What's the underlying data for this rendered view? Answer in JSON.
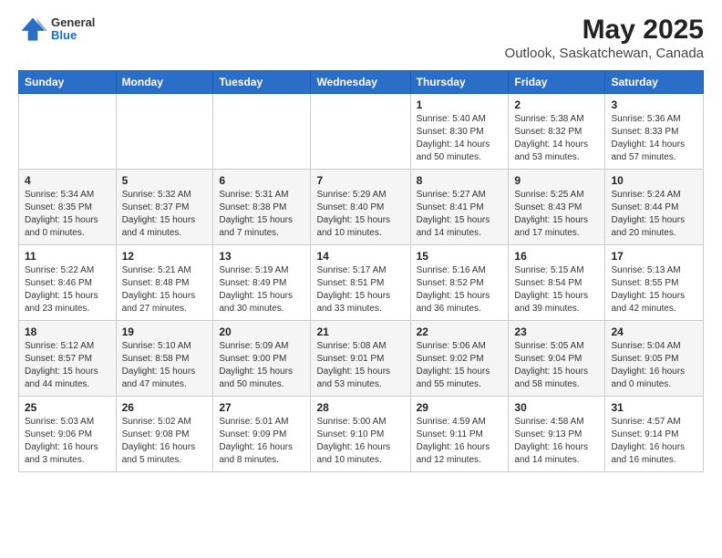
{
  "header": {
    "logo_general": "General",
    "logo_blue": "Blue",
    "title": "May 2025",
    "subtitle": "Outlook, Saskatchewan, Canada"
  },
  "days_of_week": [
    "Sunday",
    "Monday",
    "Tuesday",
    "Wednesday",
    "Thursday",
    "Friday",
    "Saturday"
  ],
  "weeks": [
    [
      {
        "day": "",
        "info": ""
      },
      {
        "day": "",
        "info": ""
      },
      {
        "day": "",
        "info": ""
      },
      {
        "day": "",
        "info": ""
      },
      {
        "day": "1",
        "info": "Sunrise: 5:40 AM\nSunset: 8:30 PM\nDaylight: 14 hours\nand 50 minutes."
      },
      {
        "day": "2",
        "info": "Sunrise: 5:38 AM\nSunset: 8:32 PM\nDaylight: 14 hours\nand 53 minutes."
      },
      {
        "day": "3",
        "info": "Sunrise: 5:36 AM\nSunset: 8:33 PM\nDaylight: 14 hours\nand 57 minutes."
      }
    ],
    [
      {
        "day": "4",
        "info": "Sunrise: 5:34 AM\nSunset: 8:35 PM\nDaylight: 15 hours\nand 0 minutes."
      },
      {
        "day": "5",
        "info": "Sunrise: 5:32 AM\nSunset: 8:37 PM\nDaylight: 15 hours\nand 4 minutes."
      },
      {
        "day": "6",
        "info": "Sunrise: 5:31 AM\nSunset: 8:38 PM\nDaylight: 15 hours\nand 7 minutes."
      },
      {
        "day": "7",
        "info": "Sunrise: 5:29 AM\nSunset: 8:40 PM\nDaylight: 15 hours\nand 10 minutes."
      },
      {
        "day": "8",
        "info": "Sunrise: 5:27 AM\nSunset: 8:41 PM\nDaylight: 15 hours\nand 14 minutes."
      },
      {
        "day": "9",
        "info": "Sunrise: 5:25 AM\nSunset: 8:43 PM\nDaylight: 15 hours\nand 17 minutes."
      },
      {
        "day": "10",
        "info": "Sunrise: 5:24 AM\nSunset: 8:44 PM\nDaylight: 15 hours\nand 20 minutes."
      }
    ],
    [
      {
        "day": "11",
        "info": "Sunrise: 5:22 AM\nSunset: 8:46 PM\nDaylight: 15 hours\nand 23 minutes."
      },
      {
        "day": "12",
        "info": "Sunrise: 5:21 AM\nSunset: 8:48 PM\nDaylight: 15 hours\nand 27 minutes."
      },
      {
        "day": "13",
        "info": "Sunrise: 5:19 AM\nSunset: 8:49 PM\nDaylight: 15 hours\nand 30 minutes."
      },
      {
        "day": "14",
        "info": "Sunrise: 5:17 AM\nSunset: 8:51 PM\nDaylight: 15 hours\nand 33 minutes."
      },
      {
        "day": "15",
        "info": "Sunrise: 5:16 AM\nSunset: 8:52 PM\nDaylight: 15 hours\nand 36 minutes."
      },
      {
        "day": "16",
        "info": "Sunrise: 5:15 AM\nSunset: 8:54 PM\nDaylight: 15 hours\nand 39 minutes."
      },
      {
        "day": "17",
        "info": "Sunrise: 5:13 AM\nSunset: 8:55 PM\nDaylight: 15 hours\nand 42 minutes."
      }
    ],
    [
      {
        "day": "18",
        "info": "Sunrise: 5:12 AM\nSunset: 8:57 PM\nDaylight: 15 hours\nand 44 minutes."
      },
      {
        "day": "19",
        "info": "Sunrise: 5:10 AM\nSunset: 8:58 PM\nDaylight: 15 hours\nand 47 minutes."
      },
      {
        "day": "20",
        "info": "Sunrise: 5:09 AM\nSunset: 9:00 PM\nDaylight: 15 hours\nand 50 minutes."
      },
      {
        "day": "21",
        "info": "Sunrise: 5:08 AM\nSunset: 9:01 PM\nDaylight: 15 hours\nand 53 minutes."
      },
      {
        "day": "22",
        "info": "Sunrise: 5:06 AM\nSunset: 9:02 PM\nDaylight: 15 hours\nand 55 minutes."
      },
      {
        "day": "23",
        "info": "Sunrise: 5:05 AM\nSunset: 9:04 PM\nDaylight: 15 hours\nand 58 minutes."
      },
      {
        "day": "24",
        "info": "Sunrise: 5:04 AM\nSunset: 9:05 PM\nDaylight: 16 hours\nand 0 minutes."
      }
    ],
    [
      {
        "day": "25",
        "info": "Sunrise: 5:03 AM\nSunset: 9:06 PM\nDaylight: 16 hours\nand 3 minutes."
      },
      {
        "day": "26",
        "info": "Sunrise: 5:02 AM\nSunset: 9:08 PM\nDaylight: 16 hours\nand 5 minutes."
      },
      {
        "day": "27",
        "info": "Sunrise: 5:01 AM\nSunset: 9:09 PM\nDaylight: 16 hours\nand 8 minutes."
      },
      {
        "day": "28",
        "info": "Sunrise: 5:00 AM\nSunset: 9:10 PM\nDaylight: 16 hours\nand 10 minutes."
      },
      {
        "day": "29",
        "info": "Sunrise: 4:59 AM\nSunset: 9:11 PM\nDaylight: 16 hours\nand 12 minutes."
      },
      {
        "day": "30",
        "info": "Sunrise: 4:58 AM\nSunset: 9:13 PM\nDaylight: 16 hours\nand 14 minutes."
      },
      {
        "day": "31",
        "info": "Sunrise: 4:57 AM\nSunset: 9:14 PM\nDaylight: 16 hours\nand 16 minutes."
      }
    ]
  ]
}
